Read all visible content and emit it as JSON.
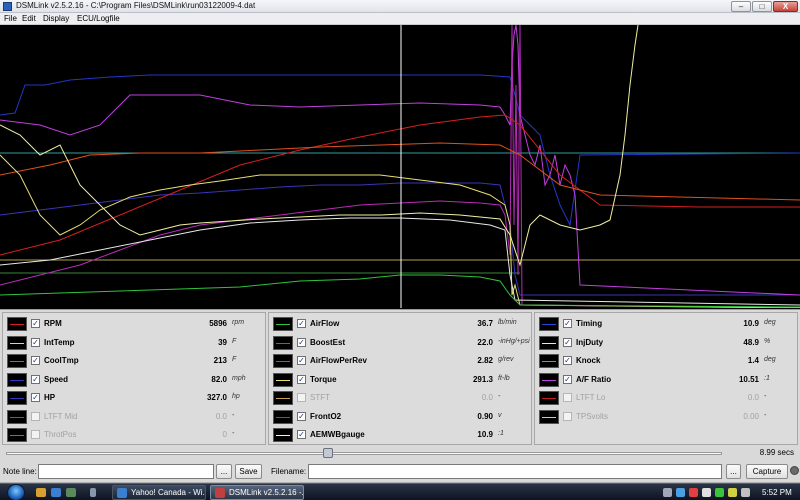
{
  "window": {
    "title": "DSMLink v2.5.2.16 - C:\\Program Files\\DSMLink\\run03122009-4.dat",
    "controls": {
      "minimize": "–",
      "maximize": "□",
      "close": "X"
    }
  },
  "menu": [
    "File",
    "Edit",
    "Display",
    "ECU/Logfile"
  ],
  "colors": {
    "plot_background": "#000000",
    "cursor_line": "#ffffff",
    "panel_background": "#d9d9d9"
  },
  "channels": {
    "col1": [
      {
        "name": "RPM",
        "value": "5896",
        "unit": "rpm",
        "color": "#d61f1f",
        "checked": true,
        "enabled": true
      },
      {
        "name": "IntTemp",
        "value": "39",
        "unit": "F",
        "color": "#f0d090",
        "checked": true,
        "enabled": true
      },
      {
        "name": "CoolTmp",
        "value": "213",
        "unit": "F",
        "color": "#e0501c",
        "checked": true,
        "enabled": true
      },
      {
        "name": "Speed",
        "value": "82.0",
        "unit": "mph",
        "color": "#2536c8",
        "checked": true,
        "enabled": true
      },
      {
        "name": "HP",
        "value": "327.0",
        "unit": "hp",
        "color": "#3a34b8",
        "checked": true,
        "enabled": true
      },
      {
        "name": "LTFT Mid",
        "value": "0.0",
        "unit": "-",
        "color": "#2a8a2a",
        "checked": false,
        "enabled": false
      },
      {
        "name": "ThrotPos",
        "value": "0",
        "unit": "-",
        "color": "#b040c0",
        "checked": false,
        "enabled": false
      }
    ],
    "col2": [
      {
        "name": "AirFlow",
        "value": "36.7",
        "unit": "lb/min",
        "color": "#2ec43a",
        "checked": true,
        "enabled": true
      },
      {
        "name": "BoostEst",
        "value": "22.0",
        "unit": "-inHg/+psi",
        "color": "#b82cb8",
        "checked": true,
        "enabled": true
      },
      {
        "name": "AirFlowPerRev",
        "value": "2.82",
        "unit": "g/rev",
        "color": "#c43878",
        "checked": true,
        "enabled": true
      },
      {
        "name": "Torque",
        "value": "291.3",
        "unit": "ft-lb",
        "color": "#e8e070",
        "checked": true,
        "enabled": true
      },
      {
        "name": "STFT",
        "value": "0.0",
        "unit": "-",
        "color": "#c8a050",
        "checked": false,
        "enabled": false
      },
      {
        "name": "FrontO2",
        "value": "0.90",
        "unit": "v",
        "color": "#3a58d8",
        "checked": true,
        "enabled": true
      },
      {
        "name": "AEMWBgauge",
        "value": "10.9",
        "unit": ":1",
        "color": "#f0f0f0",
        "checked": true,
        "enabled": true
      }
    ],
    "col3": [
      {
        "name": "Timing",
        "value": "10.9",
        "unit": "deg",
        "color": "#2a48d8",
        "checked": true,
        "enabled": true
      },
      {
        "name": "InjDuty",
        "value": "48.9",
        "unit": "%",
        "color": "#f0f0a0",
        "checked": true,
        "enabled": true
      },
      {
        "name": "Knock",
        "value": "1.4",
        "unit": "deg",
        "color": "#3ac43a",
        "checked": true,
        "enabled": true
      },
      {
        "name": "A/F Ratio",
        "value": "10.51",
        "unit": ":1",
        "color": "#c040e0",
        "checked": true,
        "enabled": true
      },
      {
        "name": "LTFT Lo",
        "value": "0.0",
        "unit": "-",
        "color": "#c02020",
        "checked": false,
        "enabled": false
      },
      {
        "name": "TPSvolts",
        "value": "0.00",
        "unit": "-",
        "color": "#c8c8c8",
        "checked": false,
        "enabled": false
      }
    ]
  },
  "timeline": {
    "readout": "8.99 secs",
    "position": 0.45
  },
  "notes": {
    "note_label": "Note line:",
    "note_value": "",
    "browse_label": "...",
    "save_label": "Save",
    "filename_label": "Filename:",
    "filename_value": "",
    "capture_label": "Capture"
  },
  "taskbar": {
    "tasks": [
      {
        "label": "Yahoo! Canada - Wi...",
        "active": false
      },
      {
        "label": "DSMLink v2.5.2.16 -...",
        "active": true
      }
    ],
    "clock": "5:52 PM"
  }
}
